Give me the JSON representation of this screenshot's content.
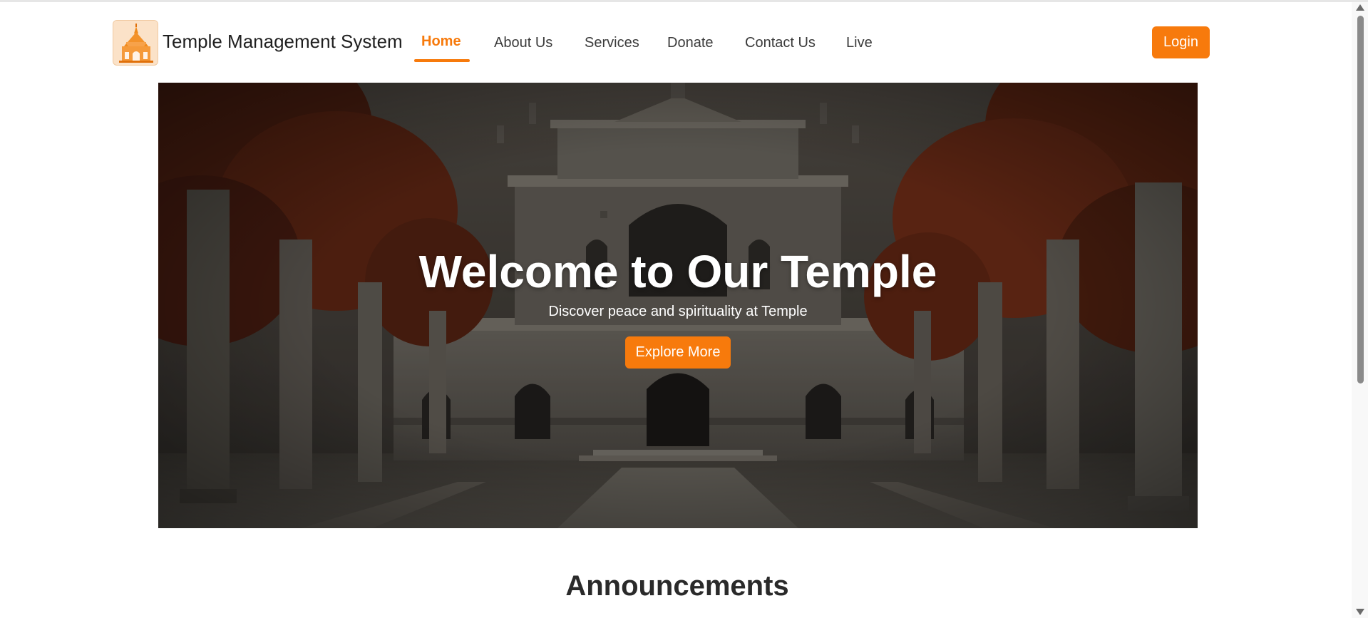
{
  "navbar": {
    "logo_icon": "temple-icon",
    "brand": "Temple Management System",
    "links": [
      "Home",
      "About Us",
      "Services",
      "Donate",
      "Contact Us",
      "Live"
    ],
    "active_link": "Home",
    "login_label": "Login"
  },
  "hero": {
    "title": "Welcome to Our Temple",
    "subtitle": "Discover peace and spirituality at Temple",
    "button_label": "Explore More"
  },
  "announcements": {
    "title": "Announcements"
  },
  "colors": {
    "accent": "#f77a0c",
    "text": "#212529",
    "background": "#ffffff"
  }
}
